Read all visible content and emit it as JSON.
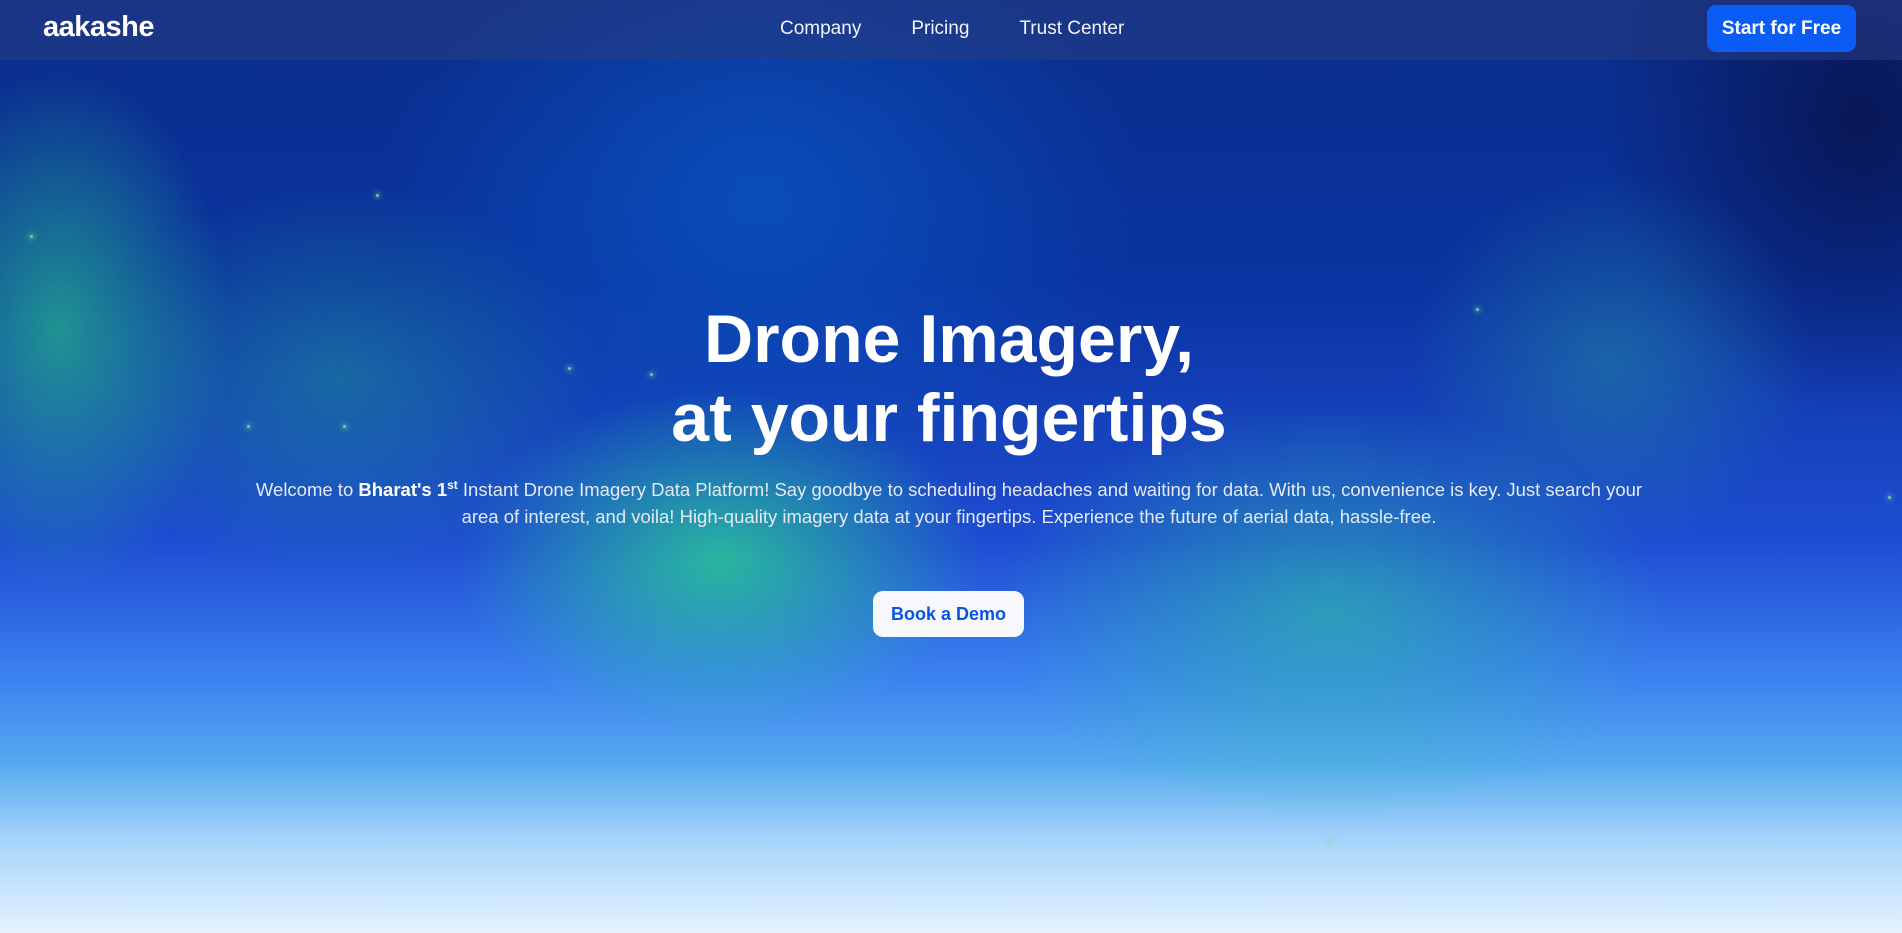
{
  "nav": {
    "logo": "aakashe",
    "links": [
      {
        "label": "Company"
      },
      {
        "label": "Pricing"
      },
      {
        "label": "Trust Center"
      }
    ],
    "cta_label": "Start for Free"
  },
  "hero": {
    "title_line1": "Drone Imagery,",
    "title_line2": "at your fingertips",
    "intro_prefix": "Welcome to ",
    "intro_brand": "Bharat's 1",
    "intro_superscript": "st",
    "intro_rest": " Instant Drone Imagery Data Platform! Say goodbye to scheduling headaches and waiting for data. With us, convenience is key. Just search your area of interest, and voila! High-quality imagery data at your fingertips. Experience the future of aerial data, hassle-free.",
    "demo_label": "Book a Demo"
  },
  "colors": {
    "primary_button": "#0a5cf5",
    "demo_text": "#0a55e0",
    "aurora_green": "#2ac896",
    "sky_deep_blue": "#0a2e8a"
  }
}
